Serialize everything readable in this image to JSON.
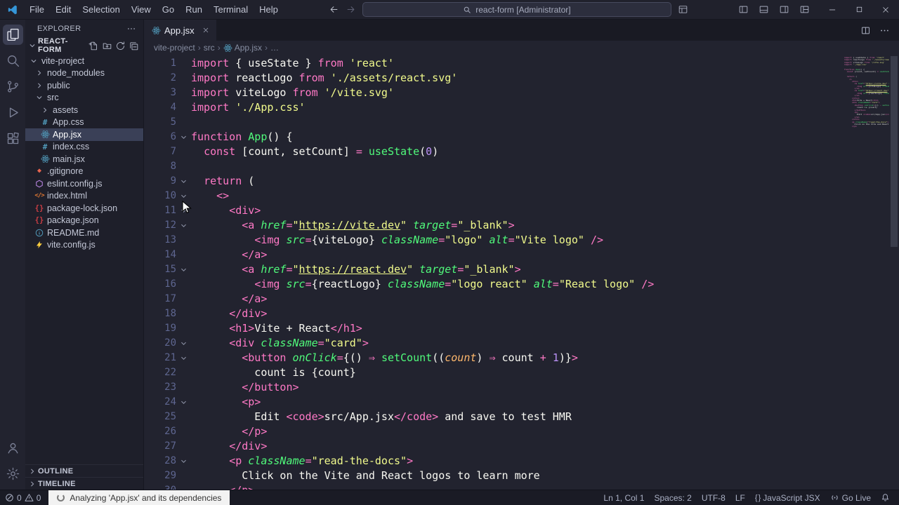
{
  "window": {
    "title_search": "react-form [Administrator]",
    "menus": [
      "File",
      "Edit",
      "Selection",
      "View",
      "Go",
      "Run",
      "Terminal",
      "Help"
    ]
  },
  "activity_bar": {
    "top": [
      {
        "name": "explorer",
        "active": true
      },
      {
        "name": "search",
        "active": false
      },
      {
        "name": "source-control",
        "active": false
      },
      {
        "name": "run-debug",
        "active": false
      },
      {
        "name": "extensions",
        "active": false
      }
    ],
    "bottom": [
      {
        "name": "account",
        "active": false
      },
      {
        "name": "settings",
        "active": false
      }
    ]
  },
  "sidebar": {
    "header": "EXPLORER",
    "section_label": "REACT-FORM",
    "section_actions": [
      "new-file",
      "new-folder",
      "refresh",
      "collapse-all"
    ],
    "tree": [
      {
        "label": "vite-project",
        "type": "folder",
        "state": "open",
        "level": 0
      },
      {
        "label": "node_modules",
        "type": "folder",
        "state": "closed",
        "level": 1
      },
      {
        "label": "public",
        "type": "folder",
        "state": "closed",
        "level": 1
      },
      {
        "label": "src",
        "type": "folder",
        "state": "open",
        "level": 1
      },
      {
        "label": "assets",
        "type": "folder",
        "state": "closed",
        "level": 2
      },
      {
        "label": "App.css",
        "type": "file",
        "icon": "css",
        "level": 2
      },
      {
        "label": "App.jsx",
        "type": "file",
        "icon": "react",
        "level": 2,
        "selected": true
      },
      {
        "label": "index.css",
        "type": "file",
        "icon": "css",
        "level": 2
      },
      {
        "label": "main.jsx",
        "type": "file",
        "icon": "react",
        "level": 2
      },
      {
        "label": ".gitignore",
        "type": "file",
        "icon": "git",
        "level": 1
      },
      {
        "label": "eslint.config.js",
        "type": "file",
        "icon": "eslint",
        "level": 1
      },
      {
        "label": "index.html",
        "type": "file",
        "icon": "html",
        "level": 1
      },
      {
        "label": "package-lock.json",
        "type": "file",
        "icon": "json",
        "level": 1
      },
      {
        "label": "package.json",
        "type": "file",
        "icon": "json",
        "level": 1
      },
      {
        "label": "README.md",
        "type": "file",
        "icon": "info",
        "level": 1
      },
      {
        "label": "vite.config.js",
        "type": "file",
        "icon": "vite",
        "level": 1
      }
    ],
    "bottom_sections": [
      "OUTLINE",
      "TIMELINE"
    ]
  },
  "editor": {
    "tab_label": "App.jsx",
    "breadcrumbs": [
      {
        "label": "vite-project"
      },
      {
        "label": "src"
      },
      {
        "label": "App.jsx",
        "icon": "react"
      },
      {
        "label": "…"
      }
    ],
    "folds": [
      6,
      9,
      10,
      11,
      12,
      15,
      20,
      21,
      24,
      28
    ],
    "lines": [
      [
        [
          "k",
          "import "
        ],
        [
          "v",
          "{ useState } "
        ],
        [
          "k",
          "from "
        ],
        [
          "s",
          "'react'"
        ]
      ],
      [
        [
          "k",
          "import "
        ],
        [
          "v",
          "reactLogo "
        ],
        [
          "k",
          "from "
        ],
        [
          "s",
          "'./assets/react.svg'"
        ]
      ],
      [
        [
          "k",
          "import "
        ],
        [
          "v",
          "viteLogo "
        ],
        [
          "k",
          "from "
        ],
        [
          "s",
          "'/vite.svg'"
        ]
      ],
      [
        [
          "k",
          "import "
        ],
        [
          "s",
          "'./App.css'"
        ]
      ],
      [],
      [
        [
          "k",
          "function "
        ],
        [
          "f",
          "App"
        ],
        [
          "v",
          "() {"
        ]
      ],
      [
        [
          "v",
          "  "
        ],
        [
          "k",
          "const "
        ],
        [
          "v",
          "[count, setCount] "
        ],
        [
          "k",
          "= "
        ],
        [
          "f",
          "useState"
        ],
        [
          "v",
          "("
        ],
        [
          "n",
          "0"
        ],
        [
          "v",
          ")"
        ]
      ],
      [],
      [
        [
          "v",
          "  "
        ],
        [
          "k",
          "return"
        ],
        [
          "v",
          " ("
        ]
      ],
      [
        [
          "v",
          "    "
        ],
        [
          "t",
          "<>"
        ]
      ],
      [
        [
          "v",
          "      "
        ],
        [
          "t",
          "<div>"
        ]
      ],
      [
        [
          "v",
          "        "
        ],
        [
          "t",
          "<a"
        ],
        [
          "v",
          " "
        ],
        [
          "a",
          "href"
        ],
        [
          "k",
          "="
        ],
        [
          "s",
          "\""
        ],
        [
          "u",
          "https://vite.dev"
        ],
        [
          "s",
          "\""
        ],
        [
          "v",
          " "
        ],
        [
          "a",
          "target"
        ],
        [
          "k",
          "="
        ],
        [
          "s",
          "\"_blank\""
        ],
        [
          "t",
          ">"
        ]
      ],
      [
        [
          "v",
          "          "
        ],
        [
          "t",
          "<img"
        ],
        [
          "v",
          " "
        ],
        [
          "a",
          "src"
        ],
        [
          "k",
          "="
        ],
        [
          "v",
          "{viteLogo}"
        ],
        [
          "v",
          " "
        ],
        [
          "a",
          "className"
        ],
        [
          "k",
          "="
        ],
        [
          "s",
          "\"logo\""
        ],
        [
          "v",
          " "
        ],
        [
          "a",
          "alt"
        ],
        [
          "k",
          "="
        ],
        [
          "s",
          "\"Vite logo\""
        ],
        [
          "t",
          " />"
        ]
      ],
      [
        [
          "v",
          "        "
        ],
        [
          "t",
          "</a>"
        ]
      ],
      [
        [
          "v",
          "        "
        ],
        [
          "t",
          "<a"
        ],
        [
          "v",
          " "
        ],
        [
          "a",
          "href"
        ],
        [
          "k",
          "="
        ],
        [
          "s",
          "\""
        ],
        [
          "u",
          "https://react.dev"
        ],
        [
          "s",
          "\""
        ],
        [
          "v",
          " "
        ],
        [
          "a",
          "target"
        ],
        [
          "k",
          "="
        ],
        [
          "s",
          "\"_blank\""
        ],
        [
          "t",
          ">"
        ]
      ],
      [
        [
          "v",
          "          "
        ],
        [
          "t",
          "<img"
        ],
        [
          "v",
          " "
        ],
        [
          "a",
          "src"
        ],
        [
          "k",
          "="
        ],
        [
          "v",
          "{reactLogo}"
        ],
        [
          "v",
          " "
        ],
        [
          "a",
          "className"
        ],
        [
          "k",
          "="
        ],
        [
          "s",
          "\"logo react\""
        ],
        [
          "v",
          " "
        ],
        [
          "a",
          "alt"
        ],
        [
          "k",
          "="
        ],
        [
          "s",
          "\"React logo\""
        ],
        [
          "t",
          " />"
        ]
      ],
      [
        [
          "v",
          "        "
        ],
        [
          "t",
          "</a>"
        ]
      ],
      [
        [
          "v",
          "      "
        ],
        [
          "t",
          "</div>"
        ]
      ],
      [
        [
          "v",
          "      "
        ],
        [
          "t",
          "<h1>"
        ],
        [
          "v",
          "Vite + React"
        ],
        [
          "t",
          "</h1>"
        ]
      ],
      [
        [
          "v",
          "      "
        ],
        [
          "t",
          "<div"
        ],
        [
          "v",
          " "
        ],
        [
          "a",
          "className"
        ],
        [
          "k",
          "="
        ],
        [
          "s",
          "\"card\""
        ],
        [
          "t",
          ">"
        ]
      ],
      [
        [
          "v",
          "        "
        ],
        [
          "t",
          "<button"
        ],
        [
          "v",
          " "
        ],
        [
          "a",
          "onClick"
        ],
        [
          "k",
          "="
        ],
        [
          "v",
          "{() "
        ],
        [
          "k",
          "⇒"
        ],
        [
          "v",
          " "
        ],
        [
          "f",
          "setCount"
        ],
        [
          "v",
          "(("
        ],
        [
          "p",
          "count"
        ],
        [
          "v",
          ") "
        ],
        [
          "k",
          "⇒"
        ],
        [
          "v",
          " count "
        ],
        [
          "k",
          "+"
        ],
        [
          "v",
          " "
        ],
        [
          "n",
          "1"
        ],
        [
          "v",
          ")}"
        ],
        [
          "t",
          ">"
        ]
      ],
      [
        [
          "v",
          "          count is {count}"
        ]
      ],
      [
        [
          "v",
          "        "
        ],
        [
          "t",
          "</button>"
        ]
      ],
      [
        [
          "v",
          "        "
        ],
        [
          "t",
          "<p>"
        ]
      ],
      [
        [
          "v",
          "          Edit "
        ],
        [
          "t",
          "<code>"
        ],
        [
          "v",
          "src/App.jsx"
        ],
        [
          "t",
          "</code>"
        ],
        [
          "v",
          " and save to test HMR"
        ]
      ],
      [
        [
          "v",
          "        "
        ],
        [
          "t",
          "</p>"
        ]
      ],
      [
        [
          "v",
          "      "
        ],
        [
          "t",
          "</div>"
        ]
      ],
      [
        [
          "v",
          "      "
        ],
        [
          "t",
          "<p "
        ],
        [
          "a",
          "className"
        ],
        [
          "k",
          "="
        ],
        [
          "s",
          "\"read-the-docs\""
        ],
        [
          "t",
          ">"
        ]
      ],
      [
        [
          "v",
          "        Click on the Vite and React logos to learn more"
        ]
      ],
      [
        [
          "v",
          "      "
        ],
        [
          "t",
          "</p>"
        ]
      ]
    ]
  },
  "status_bar": {
    "errors": "0",
    "warnings": "0",
    "progress_text": "Analyzing 'App.jsx' and its dependencies",
    "items_right": [
      {
        "name": "cursor-position",
        "label": "Ln 1, Col 1"
      },
      {
        "name": "indentation",
        "label": "Spaces: 2"
      },
      {
        "name": "encoding",
        "label": "UTF-8"
      },
      {
        "name": "eol",
        "label": "LF"
      },
      {
        "name": "language-mode",
        "label": "JavaScript JSX",
        "icon": "braces"
      },
      {
        "name": "go-live",
        "label": "Go Live",
        "icon": "broadcast"
      },
      {
        "name": "notifications",
        "label": "",
        "icon": "bell"
      }
    ]
  }
}
